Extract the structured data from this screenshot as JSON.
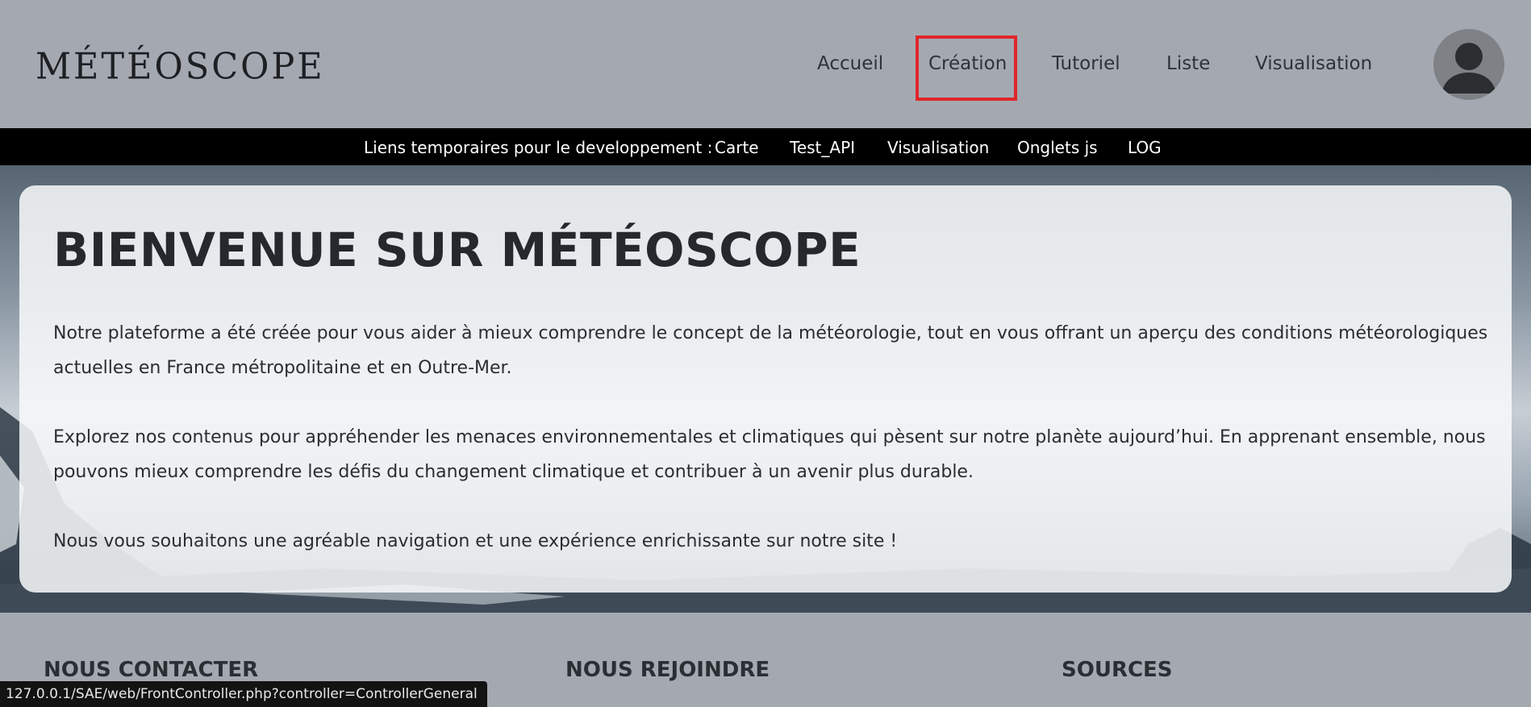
{
  "header": {
    "logo": "MÉTÉOSCOPE",
    "nav": [
      {
        "label": "Accueil"
      },
      {
        "label": "Création"
      },
      {
        "label": "Tutoriel"
      },
      {
        "label": "Liste"
      },
      {
        "label": "Visualisation"
      }
    ],
    "avatar_icon": "user-avatar-icon"
  },
  "devbar": {
    "label": "Liens temporaires pour le developpement :",
    "links": [
      {
        "label": "Carte"
      },
      {
        "label": "Test_API"
      },
      {
        "label": "Visualisation"
      },
      {
        "label": "Onglets js"
      },
      {
        "label": "LOG"
      }
    ]
  },
  "main": {
    "title": "BIENVENUE SUR MÉTÉOSCOPE",
    "paragraphs": [
      "Notre plateforme a été créée pour vous aider à mieux comprendre le concept de la météorologie, tout en vous offrant un aperçu des conditions météorologiques actuelles en France métropolitaine et en Outre-Mer.",
      "Explorez nos contenus pour appréhender les menaces environnementales et climatiques qui pèsent sur notre planète aujourd’hui. En apprenant ensemble, nous pouvons mieux comprendre les défis du changement climatique et contribuer à un avenir plus durable.",
      "Nous vous souhaitons une agréable navigation et une expérience enrichissante sur notre site !"
    ]
  },
  "footer": {
    "headings": [
      "NOUS CONTACTER",
      "NOUS REJOINDRE",
      "SOURCES"
    ]
  },
  "status_bar": {
    "url": "127.0.0.1/SAE/web/FrontController.php?controller=ControllerGeneral"
  },
  "colors": {
    "header_bg": "#a4a9b1",
    "devbar_bg": "#000000",
    "highlight": "#e0262b"
  }
}
